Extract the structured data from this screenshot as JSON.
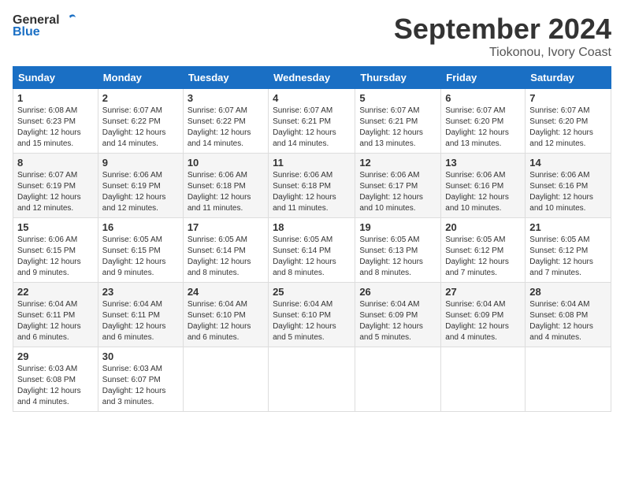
{
  "header": {
    "logo_text_general": "General",
    "logo_text_blue": "Blue",
    "month": "September 2024",
    "location": "Tiokonou, Ivory Coast"
  },
  "days_of_week": [
    "Sunday",
    "Monday",
    "Tuesday",
    "Wednesday",
    "Thursday",
    "Friday",
    "Saturday"
  ],
  "weeks": [
    [
      {
        "day": "1",
        "info": "Sunrise: 6:08 AM\nSunset: 6:23 PM\nDaylight: 12 hours\nand 15 minutes."
      },
      {
        "day": "2",
        "info": "Sunrise: 6:07 AM\nSunset: 6:22 PM\nDaylight: 12 hours\nand 14 minutes."
      },
      {
        "day": "3",
        "info": "Sunrise: 6:07 AM\nSunset: 6:22 PM\nDaylight: 12 hours\nand 14 minutes."
      },
      {
        "day": "4",
        "info": "Sunrise: 6:07 AM\nSunset: 6:21 PM\nDaylight: 12 hours\nand 14 minutes."
      },
      {
        "day": "5",
        "info": "Sunrise: 6:07 AM\nSunset: 6:21 PM\nDaylight: 12 hours\nand 13 minutes."
      },
      {
        "day": "6",
        "info": "Sunrise: 6:07 AM\nSunset: 6:20 PM\nDaylight: 12 hours\nand 13 minutes."
      },
      {
        "day": "7",
        "info": "Sunrise: 6:07 AM\nSunset: 6:20 PM\nDaylight: 12 hours\nand 12 minutes."
      }
    ],
    [
      {
        "day": "8",
        "info": "Sunrise: 6:07 AM\nSunset: 6:19 PM\nDaylight: 12 hours\nand 12 minutes."
      },
      {
        "day": "9",
        "info": "Sunrise: 6:06 AM\nSunset: 6:19 PM\nDaylight: 12 hours\nand 12 minutes."
      },
      {
        "day": "10",
        "info": "Sunrise: 6:06 AM\nSunset: 6:18 PM\nDaylight: 12 hours\nand 11 minutes."
      },
      {
        "day": "11",
        "info": "Sunrise: 6:06 AM\nSunset: 6:18 PM\nDaylight: 12 hours\nand 11 minutes."
      },
      {
        "day": "12",
        "info": "Sunrise: 6:06 AM\nSunset: 6:17 PM\nDaylight: 12 hours\nand 10 minutes."
      },
      {
        "day": "13",
        "info": "Sunrise: 6:06 AM\nSunset: 6:16 PM\nDaylight: 12 hours\nand 10 minutes."
      },
      {
        "day": "14",
        "info": "Sunrise: 6:06 AM\nSunset: 6:16 PM\nDaylight: 12 hours\nand 10 minutes."
      }
    ],
    [
      {
        "day": "15",
        "info": "Sunrise: 6:06 AM\nSunset: 6:15 PM\nDaylight: 12 hours\nand 9 minutes."
      },
      {
        "day": "16",
        "info": "Sunrise: 6:05 AM\nSunset: 6:15 PM\nDaylight: 12 hours\nand 9 minutes."
      },
      {
        "day": "17",
        "info": "Sunrise: 6:05 AM\nSunset: 6:14 PM\nDaylight: 12 hours\nand 8 minutes."
      },
      {
        "day": "18",
        "info": "Sunrise: 6:05 AM\nSunset: 6:14 PM\nDaylight: 12 hours\nand 8 minutes."
      },
      {
        "day": "19",
        "info": "Sunrise: 6:05 AM\nSunset: 6:13 PM\nDaylight: 12 hours\nand 8 minutes."
      },
      {
        "day": "20",
        "info": "Sunrise: 6:05 AM\nSunset: 6:12 PM\nDaylight: 12 hours\nand 7 minutes."
      },
      {
        "day": "21",
        "info": "Sunrise: 6:05 AM\nSunset: 6:12 PM\nDaylight: 12 hours\nand 7 minutes."
      }
    ],
    [
      {
        "day": "22",
        "info": "Sunrise: 6:04 AM\nSunset: 6:11 PM\nDaylight: 12 hours\nand 6 minutes."
      },
      {
        "day": "23",
        "info": "Sunrise: 6:04 AM\nSunset: 6:11 PM\nDaylight: 12 hours\nand 6 minutes."
      },
      {
        "day": "24",
        "info": "Sunrise: 6:04 AM\nSunset: 6:10 PM\nDaylight: 12 hours\nand 6 minutes."
      },
      {
        "day": "25",
        "info": "Sunrise: 6:04 AM\nSunset: 6:10 PM\nDaylight: 12 hours\nand 5 minutes."
      },
      {
        "day": "26",
        "info": "Sunrise: 6:04 AM\nSunset: 6:09 PM\nDaylight: 12 hours\nand 5 minutes."
      },
      {
        "day": "27",
        "info": "Sunrise: 6:04 AM\nSunset: 6:09 PM\nDaylight: 12 hours\nand 4 minutes."
      },
      {
        "day": "28",
        "info": "Sunrise: 6:04 AM\nSunset: 6:08 PM\nDaylight: 12 hours\nand 4 minutes."
      }
    ],
    [
      {
        "day": "29",
        "info": "Sunrise: 6:03 AM\nSunset: 6:08 PM\nDaylight: 12 hours\nand 4 minutes."
      },
      {
        "day": "30",
        "info": "Sunrise: 6:03 AM\nSunset: 6:07 PM\nDaylight: 12 hours\nand 3 minutes."
      },
      {
        "day": "",
        "info": ""
      },
      {
        "day": "",
        "info": ""
      },
      {
        "day": "",
        "info": ""
      },
      {
        "day": "",
        "info": ""
      },
      {
        "day": "",
        "info": ""
      }
    ]
  ]
}
